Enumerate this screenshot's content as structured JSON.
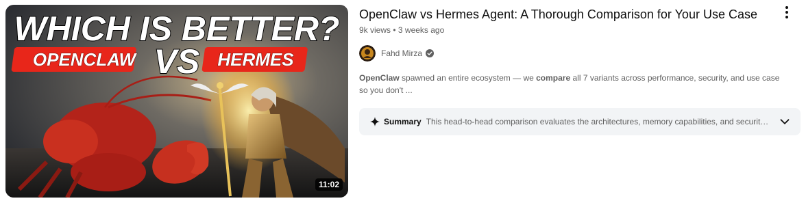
{
  "video": {
    "title": "OpenClaw vs Hermes Agent: A Thorough Comparison for Your Use Case",
    "views": "9k views",
    "age": "3 weeks ago",
    "duration": "11:02",
    "channel": "Fahd Mirza",
    "description": {
      "kw1": "OpenClaw",
      "t1": " spawned an entire ecosystem — we ",
      "kw2": "compare",
      "t2": " all 7 variants across performance, security, and use case so you don't ..."
    },
    "summary_label": "Summary",
    "summary_text": "This head-to-head comparison evaluates the architectures, memory capabilities, and security…"
  },
  "thumbnail_text": {
    "headline": "WHICH IS BETTER?",
    "left_tag": "OPENCLAW",
    "vs": "VS",
    "right_tag": "HERMES"
  },
  "icons": {
    "more": "more-vert-icon",
    "verified": "verified-check-icon",
    "summary": "sparkle-icon",
    "expand": "chevron-down-icon"
  }
}
